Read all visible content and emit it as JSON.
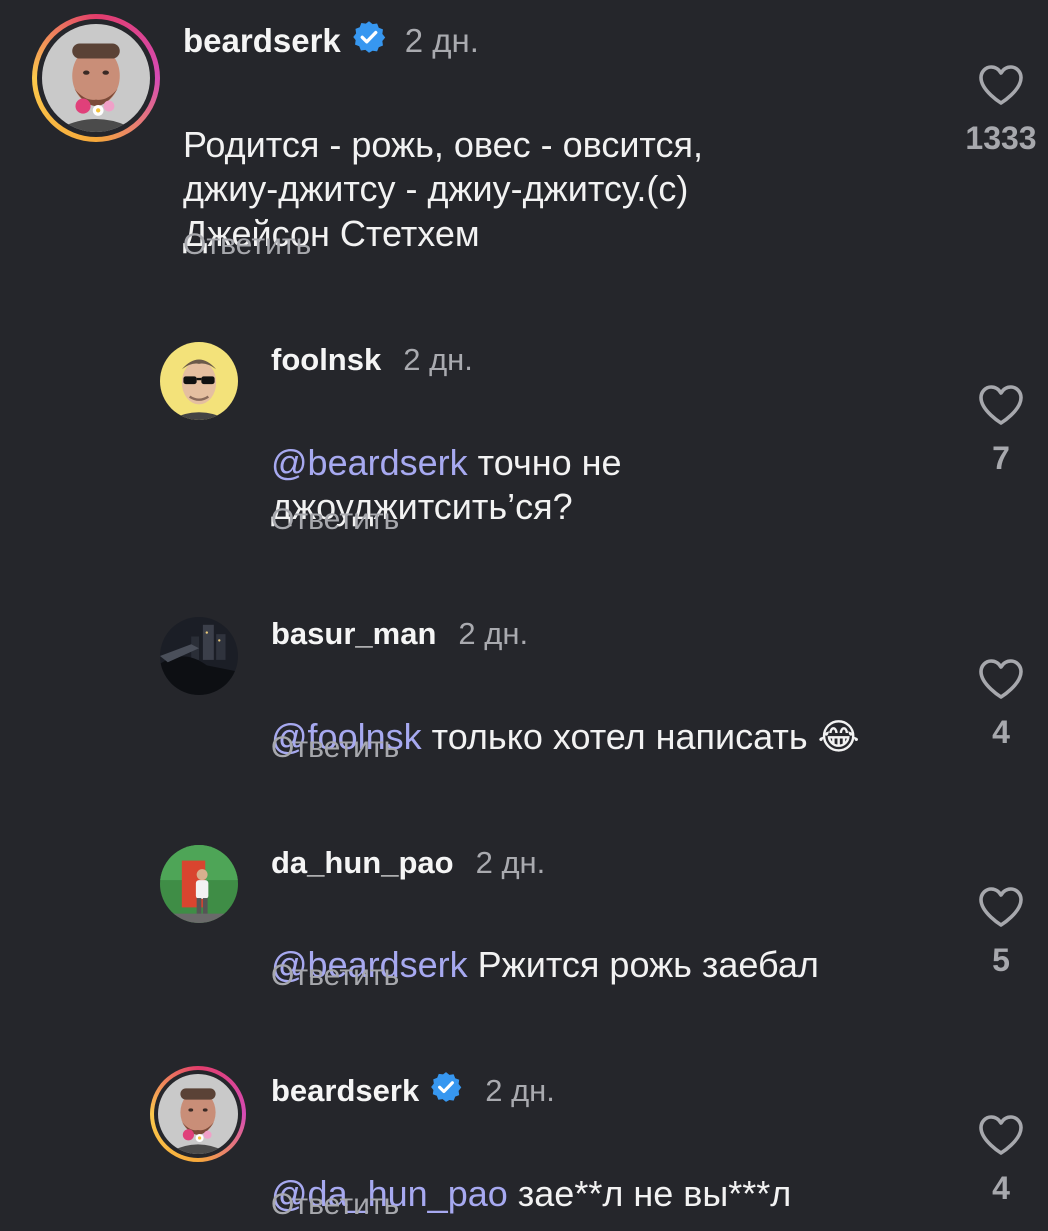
{
  "comments": [
    {
      "username": "beardserk",
      "verified": true,
      "time": "2 дн.",
      "mention": "",
      "text": "Родится - рожь, овес - овсится,\nджиу-джитсу - джиу-джитсу.(с)\nДжейсон Стетхем",
      "reply": "Ответить",
      "likes": "1333",
      "avatar": "bearded-man-flowers"
    },
    {
      "username": "foolnsk",
      "verified": false,
      "time": "2 дн.",
      "mention": "@beardserk",
      "text": " точно не\nджоуджитсить’ся?",
      "reply": "Ответить",
      "likes": "7",
      "avatar": "man-sunglasses"
    },
    {
      "username": "basur_man",
      "verified": false,
      "time": "2 дн.",
      "mention": "@foolnsk",
      "text": " только хотел написать 😂",
      "reply": "Ответить",
      "likes": "4",
      "avatar": "night-city"
    },
    {
      "username": "da_hun_pao",
      "verified": false,
      "time": "2 дн.",
      "mention": "@beardserk",
      "text": " Ржится рожь заебал",
      "reply": "Ответить",
      "likes": "5",
      "avatar": "person-standing"
    },
    {
      "username": "beardserk",
      "verified": true,
      "time": "2 дн.",
      "mention": "@da_hun_pao",
      "text": " зае**л не вы***л",
      "reply": "Ответить",
      "likes": "4",
      "avatar": "bearded-man-flowers"
    }
  ],
  "colors": {
    "background": "#25262b",
    "mention": "#a7a9f0",
    "secondary": "#a7a8ad",
    "verified": "#3797f0"
  },
  "icons": {
    "like": "heart-outline-icon",
    "verified": "verified-badge-icon"
  }
}
